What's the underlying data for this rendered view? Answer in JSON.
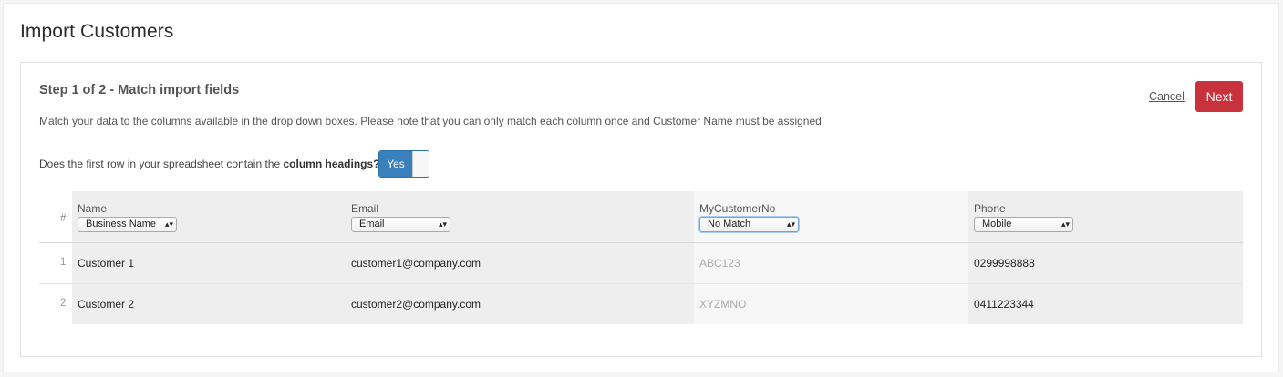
{
  "page": {
    "title": "Import Customers"
  },
  "step": {
    "title": "Step 1 of 2 - Match import fields",
    "description": "Match your data to the columns available in the drop down boxes. Please note that you can only match each column once and Customer Name must be assigned.",
    "cancel_label": "Cancel",
    "next_label": "Next"
  },
  "headings": {
    "question_prefix": "Does the first row in your spreadsheet contain the ",
    "question_bold": "column headings?",
    "toggle_label": "Yes"
  },
  "table": {
    "num_header": "#",
    "columns": [
      {
        "label": "Name",
        "selected": "Business Name"
      },
      {
        "label": "Email",
        "selected": "Email"
      },
      {
        "label": "MyCustomerNo",
        "selected": "No Match"
      },
      {
        "label": "Phone",
        "selected": "Mobile"
      }
    ],
    "rows": [
      {
        "num": "1",
        "cells": [
          "Customer 1",
          "customer1@company.com",
          "ABC123",
          "0299998888"
        ]
      },
      {
        "num": "2",
        "cells": [
          "Customer 2",
          "customer2@company.com",
          "XYZMNO",
          "0411223344"
        ]
      }
    ]
  },
  "colors": {
    "primary_button": "#c8323c",
    "toggle_on": "#3a80bb"
  }
}
